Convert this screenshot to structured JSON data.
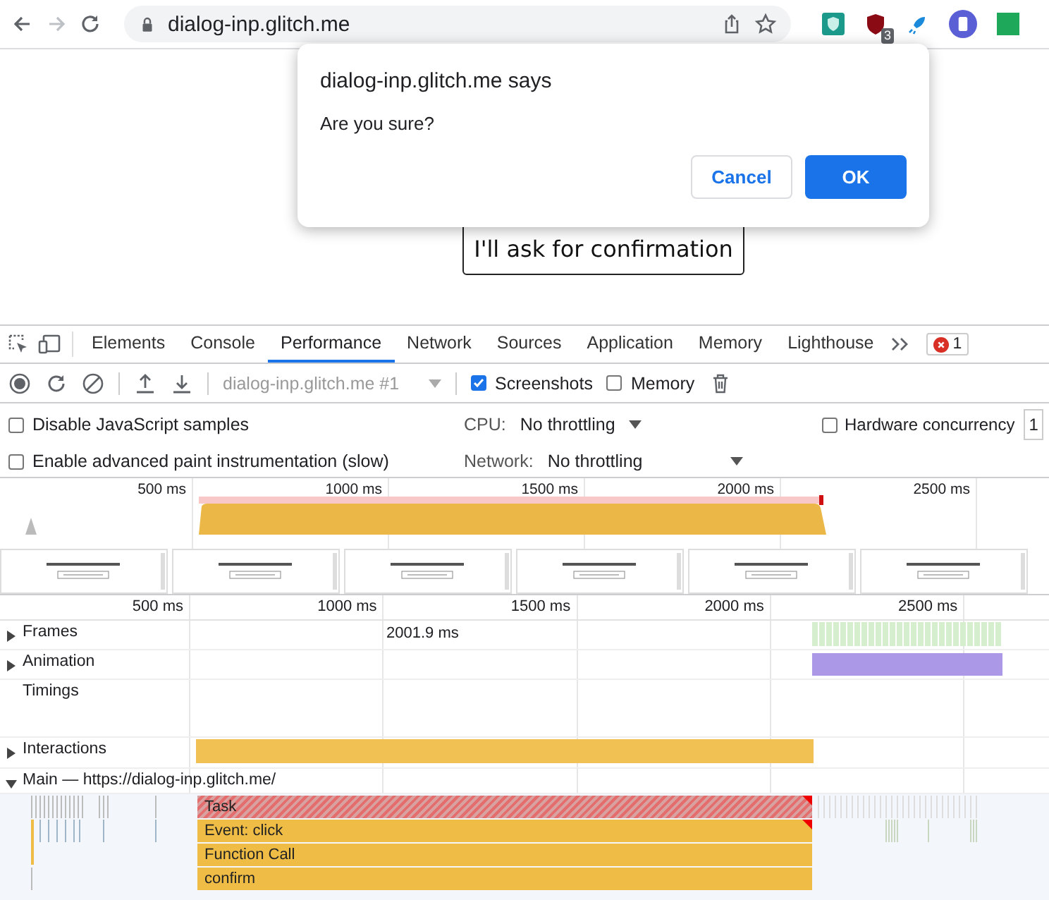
{
  "browser": {
    "url": "dialog-inp.glitch.me",
    "extension_badge": "3"
  },
  "page": {
    "button": "I'll ask for confirmation"
  },
  "dialog": {
    "title": "dialog-inp.glitch.me says",
    "message": "Are you sure?",
    "buttons": [
      {
        "label": "Cancel",
        "kind": "secondary"
      },
      {
        "label": "OK",
        "kind": "primary"
      }
    ]
  },
  "devtools": {
    "tabs": [
      {
        "label": "Elements",
        "selected": false
      },
      {
        "label": "Console",
        "selected": false
      },
      {
        "label": "Performance",
        "selected": true
      },
      {
        "label": "Network",
        "selected": false
      },
      {
        "label": "Sources",
        "selected": false
      },
      {
        "label": "Application",
        "selected": false
      },
      {
        "label": "Memory",
        "selected": false
      },
      {
        "label": "Lighthouse",
        "selected": false
      }
    ],
    "error_count": "1",
    "toolbar": {
      "recording": "dialog-inp.glitch.me #1",
      "checkboxes": [
        {
          "label": "Screenshots",
          "checked": true
        },
        {
          "label": "Memory",
          "checked": false
        }
      ]
    },
    "settings": {
      "left": [
        {
          "label": "Disable JavaScript samples",
          "checked": false
        },
        {
          "label": "Enable advanced paint instrumentation (slow)",
          "checked": false
        }
      ],
      "throttling": [
        {
          "label": "CPU:",
          "value": "No throttling"
        },
        {
          "label": "Network:",
          "value": "No throttling"
        }
      ],
      "hardware": {
        "label": "Hardware concurrency",
        "checked": false,
        "value": "1"
      }
    },
    "overview": {
      "ticks": [
        "500 ms",
        "1000 ms",
        "1500 ms",
        "2000 ms",
        "2500 ms"
      ]
    },
    "timeline": {
      "ticks": [
        "500 ms",
        "1000 ms",
        "1500 ms",
        "2000 ms",
        "2500 ms"
      ],
      "tracks": [
        {
          "name": "Frames",
          "kind": "expandable",
          "expanded": false,
          "note": "2001.9 ms"
        },
        {
          "name": "Animation",
          "kind": "expandable",
          "expanded": false
        },
        {
          "name": "Timings",
          "kind": "plain"
        },
        {
          "name": "Interactions",
          "kind": "expandable",
          "expanded": false
        },
        {
          "name": "Main — https://dialog-inp.glitch.me/",
          "kind": "expandable",
          "expanded": true
        }
      ],
      "main_entries": [
        {
          "label": "Task",
          "kind": "long-task"
        },
        {
          "label": "Event: click",
          "kind": "event"
        },
        {
          "label": "Function Call",
          "kind": "call"
        },
        {
          "label": "confirm",
          "kind": "call"
        }
      ]
    }
  }
}
